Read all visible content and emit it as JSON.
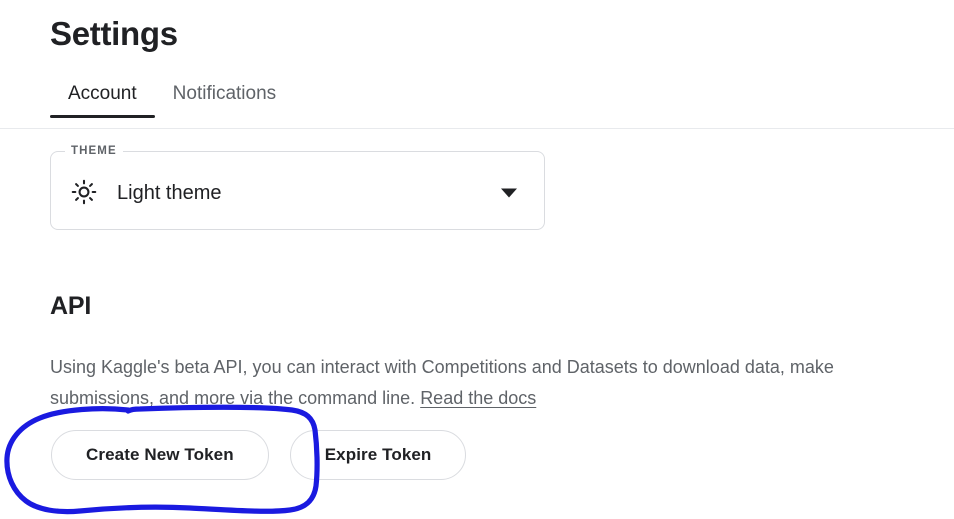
{
  "header": {
    "title": "Settings"
  },
  "tabs": [
    {
      "label": "Account",
      "active": true
    },
    {
      "label": "Notifications",
      "active": false
    }
  ],
  "theme": {
    "legend": "THEME",
    "icon": "sun-icon",
    "selected_value": "Light theme",
    "caret_icon": "chevron-down-icon",
    "options": [
      "Light theme"
    ]
  },
  "api": {
    "heading": "API",
    "description_part1": "Using Kaggle's beta API, you can interact with Competitions and Datasets to download data, make submissions, and more via the command line.",
    "link_label": "Read the docs",
    "buttons": [
      {
        "label": "Create New Token"
      },
      {
        "label": "Expire Token"
      }
    ]
  },
  "annotation": {
    "type": "hand-drawn-circle",
    "color": "#1a1ae0",
    "target": "Create New Token"
  },
  "colors": {
    "text_primary": "#202124",
    "text_secondary": "#5f6368",
    "border": "#dadce0",
    "divider": "#e8eaed",
    "background": "#ffffff",
    "annotation_blue": "#1a1ae0"
  }
}
